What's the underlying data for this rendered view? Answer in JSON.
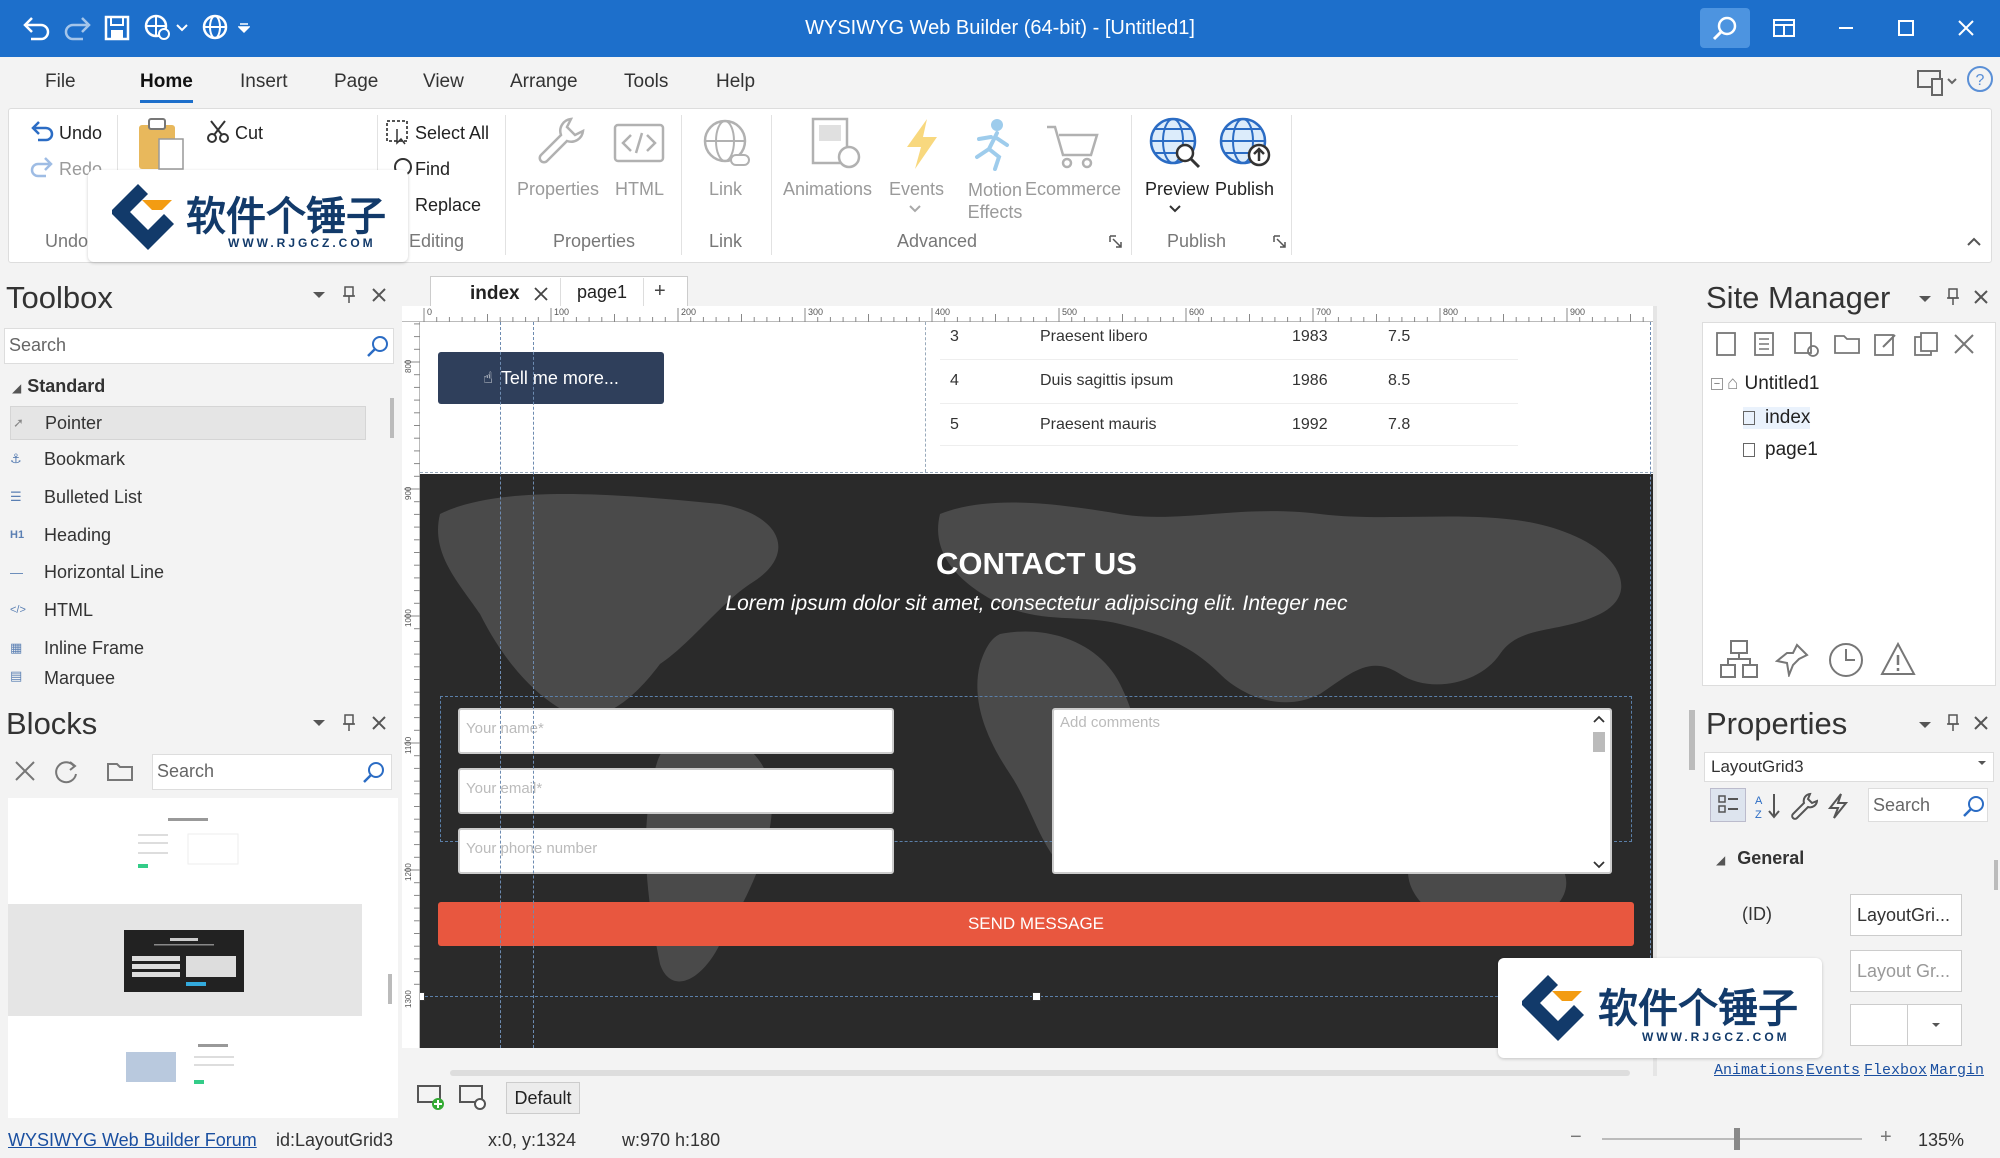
{
  "window": {
    "title": "WYSIWYG Web Builder (64-bit) - [Untitled1]"
  },
  "colors": {
    "accent": "#1d6fcb",
    "send_button": "#e8573f",
    "dark_section": "#2a2a2a",
    "tell_more_button": "#2f3f5b"
  },
  "menu": [
    "File",
    "Home",
    "Insert",
    "Page",
    "View",
    "Arrange",
    "Tools",
    "Help"
  ],
  "menu_active": "Home",
  "ribbon": {
    "undo": "Undo",
    "redo": "Redo",
    "undo_group": "Undo",
    "cut": "Cut",
    "select_all": "Select All",
    "find": "Find",
    "replace": "Replace",
    "editing_group": "Editing",
    "properties": "Properties",
    "html": "HTML",
    "properties_group": "Properties",
    "link": "Link",
    "link_group": "Link",
    "animations": "Animations",
    "events": "Events",
    "motion_effects": "Motion Effects",
    "ecommerce": "Ecommerce",
    "advanced_group": "Advanced",
    "preview": "Preview",
    "publish": "Publish",
    "publish_group": "Publish"
  },
  "toolbox": {
    "title": "Toolbox",
    "search_placeholder": "Search",
    "category": "Standard",
    "items": [
      "Pointer",
      "Bookmark",
      "Bulleted List",
      "Heading",
      "Horizontal Line",
      "HTML",
      "Inline Frame",
      "Marquee"
    ]
  },
  "blocks": {
    "title": "Blocks",
    "search_placeholder": "Search"
  },
  "tabs": [
    "index",
    "page1",
    "+"
  ],
  "ruler": [
    "0",
    "100",
    "200",
    "300",
    "400",
    "500",
    "600",
    "700",
    "800",
    "900"
  ],
  "vruler": [
    "800",
    "900",
    "1000",
    "1100",
    "1200",
    "1300"
  ],
  "canvas": {
    "tell_more": "Tell me more...",
    "table_rows": [
      {
        "n": "3",
        "name": "Praesent libero",
        "year": "1983",
        "score": "7.5"
      },
      {
        "n": "4",
        "name": "Duis sagittis ipsum",
        "year": "1986",
        "score": "8.5"
      },
      {
        "n": "5",
        "name": "Praesent mauris",
        "year": "1992",
        "score": "7.8"
      }
    ],
    "contact_title": "CONTACT US",
    "contact_sub": "Lorem ipsum dolor sit amet, consectetur adipiscing elit. Integer nec",
    "name_placeholder": "Your name*",
    "email_placeholder": "Your email*",
    "phone_placeholder": "Your phone number",
    "comments_placeholder": "Add comments",
    "send": "SEND MESSAGE"
  },
  "bottom_tools": {
    "default_btn": "Default"
  },
  "site_manager": {
    "title": "Site Manager",
    "root": "Untitled1",
    "pages": [
      "index",
      "page1"
    ]
  },
  "properties": {
    "title": "Properties",
    "object": "LayoutGrid3",
    "search_placeholder": "Search",
    "section": "General",
    "id_label": "(ID)",
    "id_value": "LayoutGri...",
    "layout_value": "Layout Gr...",
    "links": [
      "Animations",
      "Events",
      "Flexbox",
      "Margin"
    ]
  },
  "status": {
    "forum": "WYSIWYG Web Builder Forum",
    "id": "id:LayoutGrid3",
    "pos": "x:0, y:1324",
    "size": "w:970 h:180",
    "zoom": "135%",
    "zoom_level": 0.52
  },
  "watermark": {
    "cn": "软件个锤子",
    "url": "WWW.RJGCZ.COM"
  }
}
